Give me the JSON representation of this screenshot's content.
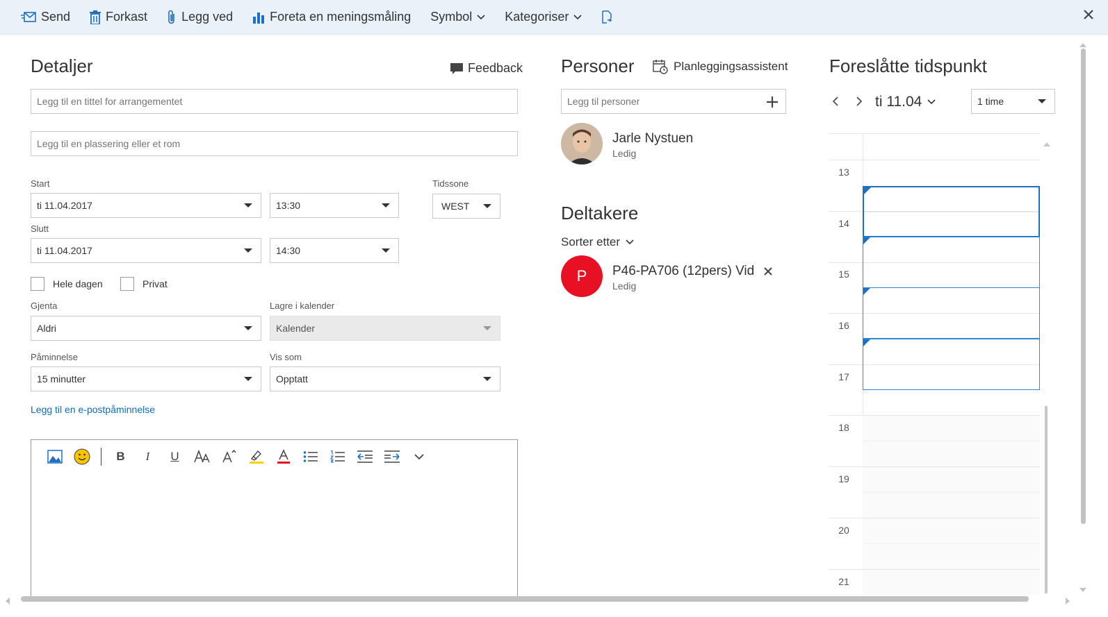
{
  "toolbar": {
    "send": "Send",
    "discard": "Forkast",
    "attach": "Legg ved",
    "poll": "Foreta en meningsmåling",
    "symbol": "Symbol",
    "categorize": "Kategoriser"
  },
  "details": {
    "heading": "Detaljer",
    "feedback": "Feedback",
    "title_placeholder": "Legg til en tittel for arrangementet",
    "location_placeholder": "Legg til en plassering eller et rom",
    "start_label": "Start",
    "start_date": "ti 11.04.2017",
    "start_time": "13:30",
    "timezone_label": "Tidssone",
    "timezone": "WEST",
    "end_label": "Slutt",
    "end_date": "ti 11.04.2017",
    "end_time": "14:30",
    "all_day": "Hele dagen",
    "private": "Privat",
    "repeat_label": "Gjenta",
    "repeat": "Aldri",
    "save_in_label": "Lagre i kalender",
    "save_in": "Kalender",
    "reminder_label": "Påminnelse",
    "reminder": "15 minutter",
    "show_as_label": "Vis som",
    "show_as": "Opptatt",
    "email_reminder_link": "Legg til en e-postpåminnelse"
  },
  "editor": {
    "bold": "B",
    "italic": "I",
    "underline": "U"
  },
  "people": {
    "heading": "Personer",
    "scheduling_assistant": "Planleggingsassistent",
    "add_placeholder": "Legg til personer",
    "organizer_name": "Jarle Nystuen",
    "organizer_status": "Ledig",
    "attendees_heading": "Deltakere",
    "sort_by": "Sorter etter",
    "attendee_initial": "P",
    "attendee_name": "P46-PA706 (12pers) Vid",
    "attendee_status": "Ledig"
  },
  "suggested": {
    "heading": "Foreslåtte tidspunkt",
    "date": "ti 11.04",
    "duration": "1 time",
    "hours": [
      "13",
      "14",
      "15",
      "16",
      "17",
      "18",
      "19",
      "20",
      "21"
    ]
  },
  "colors": {
    "accent": "#0f6cbd",
    "attendee_avatar": "#e81123",
    "toolbar_bg": "#eaf1f8"
  }
}
